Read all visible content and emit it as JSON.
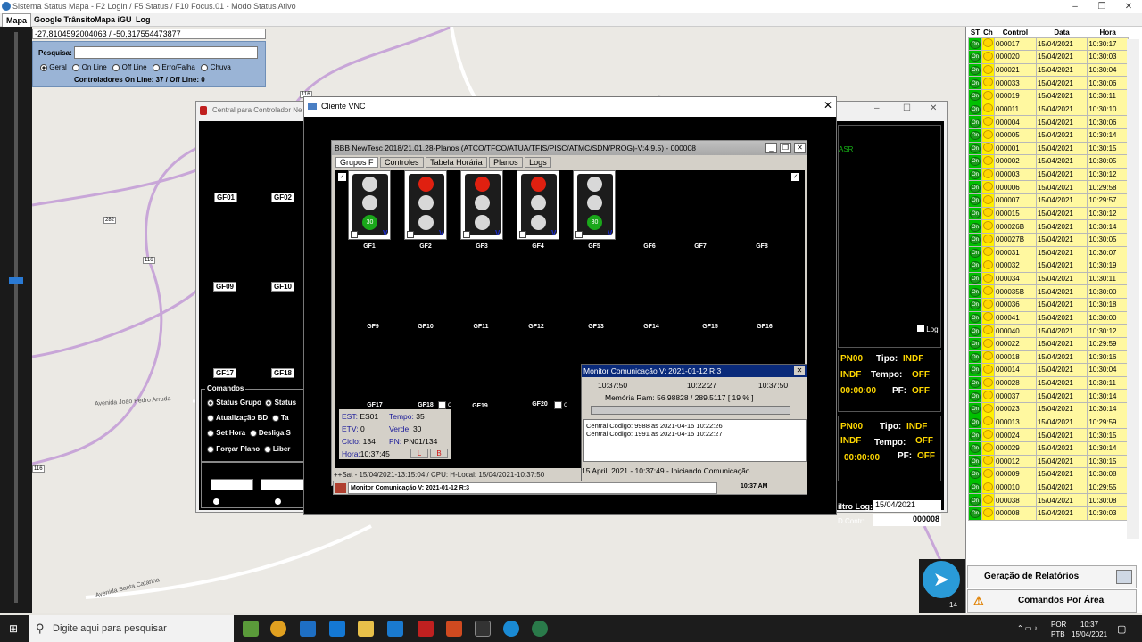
{
  "window": {
    "title": "Sistema Status Mapa - F2 Login / F5 Status / F10 Focus.01 - Modo Status Ativo"
  },
  "menu": [
    "Mapa",
    "Google Trânsito",
    "Mapa iGU",
    "Log"
  ],
  "map": {
    "coords": "-27,8104592004063 / -50,317554473877",
    "search_label": "Pesquisa:",
    "filters": [
      "Geral",
      "On Line",
      "Off Line",
      "Erro/Falha",
      "Chuva"
    ],
    "status_line": "Controladores On Line: 37 / Off Line: 0",
    "road_labels": [
      "Avenida João Pedro Arruda",
      "Avenida Santa Catarina",
      "282",
      "116",
      "116",
      "116"
    ],
    "badge": "14"
  },
  "central_window": {
    "title": "Central para Controlador Ne",
    "groups": [
      "GF01",
      "GF02",
      "GF09",
      "GF10",
      "GF17",
      "GF18"
    ],
    "comandos_title": "Comandos",
    "comandos": [
      "Status Grupo",
      "Status",
      "Atualização BD",
      "Ta",
      "Set Hora",
      "Desliga S",
      "Forçar Plano",
      "Liber"
    ],
    "right_asr": "ASR",
    "log_label": "Log",
    "block1": {
      "pn": "PN00",
      "tipo_label": "Tipo:",
      "tipo": "INDF",
      "indf": "INDF",
      "tempo_label": "Tempo:",
      "tempo": "OFF",
      "hora": "00:00:00",
      "pf_label": "PF:",
      "pf": "OFF"
    },
    "block2": {
      "pn": "PN00",
      "tipo_label": "Tipo:",
      "tipo": "INDF",
      "indf": "INDF",
      "tempo_label": "Tempo:",
      "tempo": "OFF",
      "hora": "00:00:00",
      "pf_label": "PF:",
      "pf": "OFF"
    },
    "filtro_log_label": "iltro Log:",
    "filtro_log_date": "15/04/2021",
    "contr_label": "D Contr:",
    "contr_value": "000008"
  },
  "vnc": {
    "title": "Cliente VNC",
    "app_title": "BBB NewTesc 2018/21.01.28-Planos (ATCO/TFCO/ATUA/TFIS/PISC/ATMC/SDN/PROG)-V:4.9.5) - 000008",
    "tabs": [
      "Grupos F",
      "Controles",
      "Tabela Horária",
      "Planos",
      "Logs"
    ],
    "traffic_lights": [
      {
        "label": "GF1",
        "state": "green",
        "count": "30"
      },
      {
        "label": "GF2",
        "state": "red"
      },
      {
        "label": "GF3",
        "state": "red"
      },
      {
        "label": "GF4",
        "state": "red"
      },
      {
        "label": "GF5",
        "state": "green",
        "count": "30"
      }
    ],
    "row1_empty": [
      "GF6",
      "GF7",
      "GF8"
    ],
    "row2": [
      "GF9",
      "GF10",
      "GF11",
      "GF12",
      "GF13",
      "GF14",
      "GF15",
      "GF16"
    ],
    "row3": [
      "GF17",
      "GF18",
      "GF19",
      "GF20"
    ],
    "v_label": "V",
    "c_label": "C",
    "status": {
      "est_label": "EST:",
      "est": "ES01",
      "tempo_label": "Tempo:",
      "tempo": "35",
      "etv_label": "ETV:",
      "etv": "0",
      "verde_label": "Verde:",
      "verde": "30",
      "ciclo_label": "Ciclo:",
      "ciclo": "134",
      "pn_label": "PN:",
      "pn": "PN01/134",
      "hora_label": "Hora:",
      "hora": "10:37:45",
      "l": "L",
      "b": "B"
    },
    "statusbar": "++Sat - 15/04/2021-13:15:04 / CPU: H-Local: 15/04/2021-10:37:50",
    "monitor": {
      "title": "Monitor Comunicação V: 2021-01-12 R:3",
      "times": [
        "10:37:50",
        "10:22:27",
        "10:37:50"
      ],
      "memory": "Memória Ram: 56.98828 / 289.5117 [ 19 % ]",
      "log": [
        "Central Codigo: 9988 as 2021-04-15 10:22:26",
        "Central Codigo: 1991 as 2021-04-15 10:22:27"
      ],
      "footer": "15 April, 2021 - 10:37:49 - Iniciando Comunicação..."
    },
    "inner_taskbar": {
      "item": "Monitor Comunicação V: 2021-01-12 R:3",
      "clock": "10:37 AM"
    }
  },
  "right_panel": {
    "headers": [
      "ST",
      "Ch",
      "Control",
      "Data",
      "Hora"
    ],
    "on_label": "On",
    "rows": [
      [
        "000017",
        "15/04/2021",
        "10:30:17"
      ],
      [
        "000020",
        "15/04/2021",
        "10:30:03"
      ],
      [
        "000021",
        "15/04/2021",
        "10:30:04"
      ],
      [
        "000033",
        "15/04/2021",
        "10:30:06"
      ],
      [
        "000019",
        "15/04/2021",
        "10:30:11"
      ],
      [
        "000011",
        "15/04/2021",
        "10:30:10"
      ],
      [
        "000004",
        "15/04/2021",
        "10:30:06"
      ],
      [
        "000005",
        "15/04/2021",
        "10:30:14"
      ],
      [
        "000001",
        "15/04/2021",
        "10:30:15"
      ],
      [
        "000002",
        "15/04/2021",
        "10:30:05"
      ],
      [
        "000003",
        "15/04/2021",
        "10:30:12"
      ],
      [
        "000006",
        "15/04/2021",
        "10:29:58"
      ],
      [
        "000007",
        "15/04/2021",
        "10:29:57"
      ],
      [
        "000015",
        "15/04/2021",
        "10:30:12"
      ],
      [
        "000026B",
        "15/04/2021",
        "10:30:14"
      ],
      [
        "000027B",
        "15/04/2021",
        "10:30:05"
      ],
      [
        "000031",
        "15/04/2021",
        "10:30:07"
      ],
      [
        "000032",
        "15/04/2021",
        "10:30:19"
      ],
      [
        "000034",
        "15/04/2021",
        "10:30:11"
      ],
      [
        "000035B",
        "15/04/2021",
        "10:30:00"
      ],
      [
        "000036",
        "15/04/2021",
        "10:30:18"
      ],
      [
        "000041",
        "15/04/2021",
        "10:30:00"
      ],
      [
        "000040",
        "15/04/2021",
        "10:30:12"
      ],
      [
        "000022",
        "15/04/2021",
        "10:29:59"
      ],
      [
        "000018",
        "15/04/2021",
        "10:30:16"
      ],
      [
        "000014",
        "15/04/2021",
        "10:30:04"
      ],
      [
        "000028",
        "15/04/2021",
        "10:30:11"
      ],
      [
        "000037",
        "15/04/2021",
        "10:30:14"
      ],
      [
        "000023",
        "15/04/2021",
        "10:30:14"
      ],
      [
        "000013",
        "15/04/2021",
        "10:29:59"
      ],
      [
        "000024",
        "15/04/2021",
        "10:30:15"
      ],
      [
        "000029",
        "15/04/2021",
        "10:30:14"
      ],
      [
        "000012",
        "15/04/2021",
        "10:30:15"
      ],
      [
        "000009",
        "15/04/2021",
        "10:30:08"
      ],
      [
        "000010",
        "15/04/2021",
        "10:29:55"
      ],
      [
        "000038",
        "15/04/2021",
        "10:30:08"
      ],
      [
        "000008",
        "15/04/2021",
        "10:30:03"
      ]
    ],
    "btn_relatorios": "Geração de Relatórios",
    "btn_comandos": "Comandos Por Área"
  },
  "taskbar": {
    "search_placeholder": "Digite aqui para pesquisar",
    "lang1": "POR",
    "lang2": "PTB",
    "time": "10:37",
    "date": "15/04/2021"
  },
  "colors": {
    "accent_blue": "#0a2a7a",
    "yellow": "#ffd800",
    "green": "#1d9b1d",
    "red": "#e02010"
  }
}
